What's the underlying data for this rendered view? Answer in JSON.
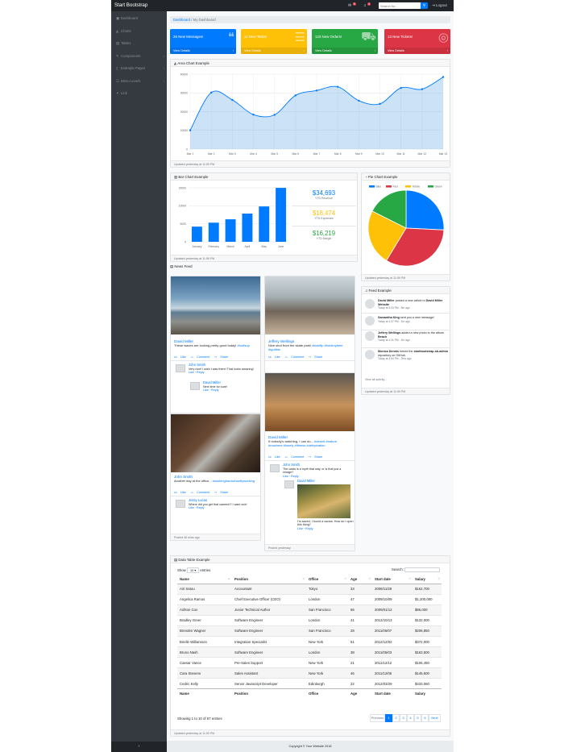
{
  "app": {
    "brand": "Start Bootstrap",
    "alerts_count": "4",
    "messages_count": "8",
    "search_placeholder": "Search for...",
    "logout": "Logout"
  },
  "sidebar": {
    "items": [
      {
        "label": "Dashboard",
        "icon": "dashboard-icon",
        "glyph": "▣"
      },
      {
        "label": "Charts",
        "icon": "area-chart-icon",
        "glyph": "◭"
      },
      {
        "label": "Tables",
        "icon": "table-icon",
        "glyph": "▤"
      },
      {
        "label": "Components",
        "icon": "wrench-icon",
        "glyph": "✎",
        "chevron": "›"
      },
      {
        "label": "Example Pages",
        "icon": "file-icon",
        "glyph": "▯",
        "chevron": "›"
      },
      {
        "label": "Menu Levels",
        "icon": "sitemap-icon",
        "glyph": "☷",
        "chevron": "›"
      },
      {
        "label": "Link",
        "icon": "link-icon",
        "glyph": "⚭"
      }
    ],
    "toggler": "‹"
  },
  "breadcrumb": {
    "home": "Dashboard",
    "sep": "/",
    "current": "My Dashboard"
  },
  "stat_cards": [
    {
      "text": "26 New Messages!",
      "footer": "View Details",
      "color": "#007bff",
      "icon": "comments-icon",
      "glyph": "❝"
    },
    {
      "text": "11 New Tasks!",
      "footer": "View Details",
      "color": "#ffc107",
      "icon": "list-icon",
      "glyph": "☰"
    },
    {
      "text": "123 New Orders!",
      "footer": "View Details",
      "color": "#28a745",
      "icon": "shopping-cart-icon",
      "glyph": "⛟"
    },
    {
      "text": "13 New Tickets!",
      "footer": "View Details",
      "color": "#dc3545",
      "icon": "support-icon",
      "glyph": "◎"
    }
  ],
  "area_card": {
    "title": "Area Chart Example",
    "footer": "Updated yesterday at 11:59 PM"
  },
  "bar_card": {
    "title": "Bar Chart Example",
    "footer": "Updated yesterday at 11:59 PM"
  },
  "pie_card": {
    "title": "Pie Chart Example",
    "footer": "Updated yesterday at 11:59 PM"
  },
  "summary": [
    {
      "value": "$34,693",
      "label": "YTD Revenue",
      "color": "#007bff"
    },
    {
      "value": "$18,474",
      "label": "YTD Expenses",
      "color": "#ffc107"
    },
    {
      "value": "$16,219",
      "label": "YTD Margin",
      "color": "#28a745"
    }
  ],
  "chart_data": [
    {
      "type": "area",
      "x": [
        "Mar 1",
        "Mar 2",
        "Mar 3",
        "Mar 4",
        "Mar 5",
        "Mar 6",
        "Mar 7",
        "Mar 8",
        "Mar 9",
        "Mar 10",
        "Mar 11",
        "Mar 12",
        "Mar 13"
      ],
      "values": [
        10000,
        30162,
        26263,
        18394,
        18287,
        28682,
        31274,
        33259,
        25849,
        24159,
        32651,
        31984,
        38451
      ],
      "y_ticks": [
        "0",
        "10000",
        "20000",
        "30000",
        "40000"
      ],
      "ylim": [
        0,
        40000
      ],
      "color": "#007bff"
    },
    {
      "type": "bar",
      "categories": [
        "January",
        "February",
        "March",
        "April",
        "May",
        "June"
      ],
      "values": [
        4215,
        5312,
        6251,
        7841,
        9821,
        14984
      ],
      "y_ticks": [
        "0",
        "5000",
        "10000",
        "15000"
      ],
      "ylim": [
        0,
        15000
      ],
      "color": "#007bff"
    },
    {
      "type": "pie",
      "categories": [
        "Blue",
        "Red",
        "Yellow",
        "Green"
      ],
      "values": [
        12.21,
        15.58,
        11.25,
        8.32
      ],
      "colors": [
        "#007bff",
        "#dc3545",
        "#ffc107",
        "#28a745"
      ]
    }
  ],
  "news": {
    "title": "News Feed"
  },
  "posts": [
    {
      "name": "David Miller",
      "body": "These waves are looking pretty good today!",
      "tags": "#surfsup",
      "like": "Like",
      "comment": "Comment",
      "share": "Share",
      "posted": "Posted 32 mins ago",
      "img": "beach",
      "comments": [
        {
          "name": "John Smith",
          "body": "Very nice! I wish I was there! That looks amazing!",
          "like": "Like",
          "reply": "Reply"
        },
        {
          "name": "David Miller",
          "body": "Next time for sure!",
          "like": "Like",
          "reply": "Reply"
        }
      ]
    },
    {
      "name": "Jeffery Wellings",
      "body": "Nice shot from the skate park!",
      "tags": "#kickflip #holdmybeer #igotthis",
      "like": "Like",
      "comment": "Comment",
      "share": "Share",
      "posted": "Posted 1 hr ago",
      "img": "skatepark",
      "comments": []
    },
    {
      "name": "John Smith",
      "body": "Another day at the office...",
      "tags": "#workinghardorhardlyworking",
      "like": "Like",
      "comment": "Comment",
      "share": "Share",
      "posted": "Posted 46 mins ago",
      "img": "desk",
      "comments": [
        {
          "name": "Jessy Lucas",
          "body": "Where did you get that camera?! I want one!",
          "like": "Like",
          "reply": "Reply"
        }
      ]
    },
    {
      "name": "David Miller",
      "body": "If nobody's watching, I can do...",
      "tags": "#desert #nature #nowhere #lonely #fitness #dehydration",
      "like": "Like",
      "comment": "Comment",
      "share": "Share",
      "posted": "Posted yesterday",
      "img": "desert",
      "comments": [
        {
          "name": "John Smith",
          "body": "The oasis is a myth that way, or is that just a mirage?",
          "like": "Like",
          "reply": "Reply"
        },
        {
          "name": "David Miller",
          "body": "I'm saved, I found a cactus. How do I open this thing?",
          "like": "Like",
          "reply": "Reply"
        }
      ]
    }
  ],
  "feed": {
    "title": "Feed Example",
    "footer": "Updated yesterday at 11:59 PM",
    "view_all": "View all activity...",
    "items": [
      {
        "who": "David Miller",
        "what": "posted a new article to",
        "target": "David Miller Website",
        "time": "Today at 5:43 PM - 5m ago"
      },
      {
        "who": "Samantha King",
        "what": "sent you a new message!",
        "target": "",
        "time": "Today at 4:37 PM - 1hr ago"
      },
      {
        "who": "Jeffery Wellings",
        "what": "added a new photo to the album",
        "target": "Beach",
        "time": "Today at 4:31 PM - 1hr ago"
      },
      {
        "who": "Monica Dennis",
        "what": "forked the",
        "target": "startbootstrap-sb-admin",
        "after": "repository on GitHub.",
        "time": "Today at 3:54 PM - 2hrs ago"
      }
    ]
  },
  "table": {
    "title": "Data Table Example",
    "show": "Show",
    "entries": "entries",
    "length": "10",
    "search": "Search:",
    "columns": [
      "Name",
      "Position",
      "Office",
      "Age",
      "Start date",
      "Salary"
    ],
    "rows": [
      [
        "Airi Satou",
        "Accountant",
        "Tokyo",
        "33",
        "2008/11/28",
        "$162,700"
      ],
      [
        "Angelica Ramos",
        "Chief Executive Officer (CEO)",
        "London",
        "47",
        "2009/10/09",
        "$1,200,000"
      ],
      [
        "Ashton Cox",
        "Junior Technical Author",
        "San Francisco",
        "66",
        "2009/01/12",
        "$86,000"
      ],
      [
        "Bradley Greer",
        "Software Engineer",
        "London",
        "41",
        "2012/10/13",
        "$132,000"
      ],
      [
        "Brenden Wagner",
        "Software Engineer",
        "San Francisco",
        "28",
        "2011/06/07",
        "$206,850"
      ],
      [
        "Brielle Williamson",
        "Integration Specialist",
        "New York",
        "61",
        "2012/12/02",
        "$372,000"
      ],
      [
        "Bruno Nash",
        "Software Engineer",
        "London",
        "38",
        "2011/05/03",
        "$163,500"
      ],
      [
        "Caesar Vance",
        "Pre-Sales Support",
        "New York",
        "21",
        "2011/12/12",
        "$106,450"
      ],
      [
        "Cara Stevens",
        "Sales Assistant",
        "New York",
        "46",
        "2011/12/06",
        "$145,600"
      ],
      [
        "Cedric Kelly",
        "Senior Javascript Developer",
        "Edinburgh",
        "22",
        "2012/03/29",
        "$433,060"
      ]
    ],
    "info": "Showing 1 to 10 of 57 entries",
    "prev": "Previous",
    "next": "Next",
    "pages": [
      "1",
      "2",
      "3",
      "4",
      "5",
      "6"
    ],
    "footer": "Updated yesterday at 11:59 PM"
  },
  "footer": "Copyright © Your Website 2018"
}
